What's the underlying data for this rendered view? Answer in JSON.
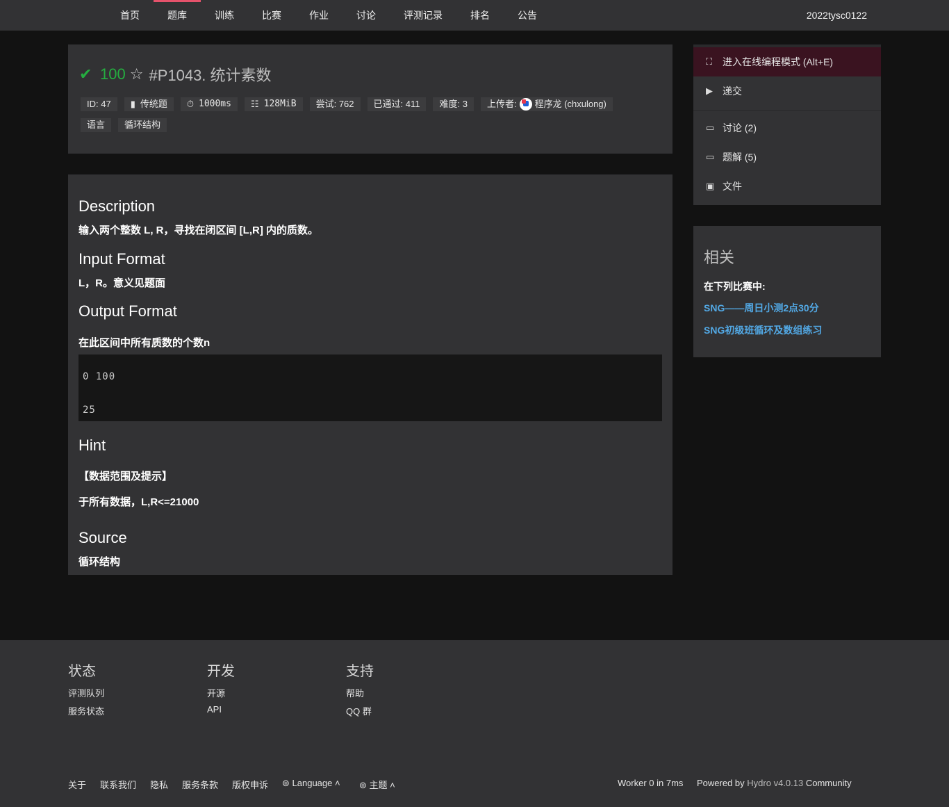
{
  "nav": {
    "items": [
      {
        "label": "首页",
        "active": false
      },
      {
        "label": "题库",
        "active": true
      },
      {
        "label": "训练",
        "active": false
      },
      {
        "label": "比赛",
        "active": false
      },
      {
        "label": "作业",
        "active": false
      },
      {
        "label": "讨论",
        "active": false
      },
      {
        "label": "评测记录",
        "active": false
      },
      {
        "label": "排名",
        "active": false
      },
      {
        "label": "公告",
        "active": false
      }
    ],
    "user": "2022tysc0122"
  },
  "problem": {
    "score": "100",
    "title": "#P1043. 统计素数",
    "meta": {
      "id": "ID: 47",
      "type": "传统题",
      "time": "1000ms",
      "memory": "128MiB",
      "tried": "尝试: 762",
      "passed": "已通过: 411",
      "difficulty": "难度: 3",
      "uploader_label": "上传者:",
      "uploader": "程序龙 (chxulong)"
    },
    "tags": [
      "语言",
      "循环结构"
    ]
  },
  "content": {
    "description_heading": "Description",
    "description": "输入两个整数 L, R，寻找在闭区间 [L,R] 内的质数。",
    "input_heading": "Input Format",
    "input": "L，R。意义见题面",
    "output_heading": "Output Format",
    "output": "在此区间中所有质数的个数n",
    "sample_input": "0 100",
    "sample_output": "25",
    "hint_heading": "Hint",
    "hint_title": "【数据范围及提示】",
    "hint": "于所有数据，L,R<=21000",
    "source_heading": "Source",
    "source": "循环结构"
  },
  "sidebar": {
    "ide": "进入在线编程模式 (Alt+E)",
    "submit": "递交",
    "discuss": "讨论 (2)",
    "solutions": "题解 (5)",
    "files": "文件",
    "related_title": "相关",
    "related_label": "在下列比赛中:",
    "contests": [
      "SNG——周日小测2点30分",
      "SNG初级班循环及数组练习"
    ]
  },
  "footer": {
    "columns": [
      {
        "title": "状态",
        "links": [
          "评测队列",
          "服务状态"
        ]
      },
      {
        "title": "开发",
        "links": [
          "开源",
          "API"
        ]
      },
      {
        "title": "支持",
        "links": [
          "帮助",
          "QQ 群"
        ]
      }
    ],
    "bottom_links": [
      "关于",
      "联系我们",
      "隐私",
      "服务条款",
      "版权申诉"
    ],
    "language": "Language",
    "theme": "主题",
    "worker": "Worker 0 in 7ms",
    "powered_prefix": "Powered by",
    "powered_name": "Hydro v4.0.13",
    "powered_suffix": "Community"
  },
  "colors": {
    "accent": "#e5526b",
    "accepted": "#25ad40",
    "link": "#52a8e4"
  }
}
